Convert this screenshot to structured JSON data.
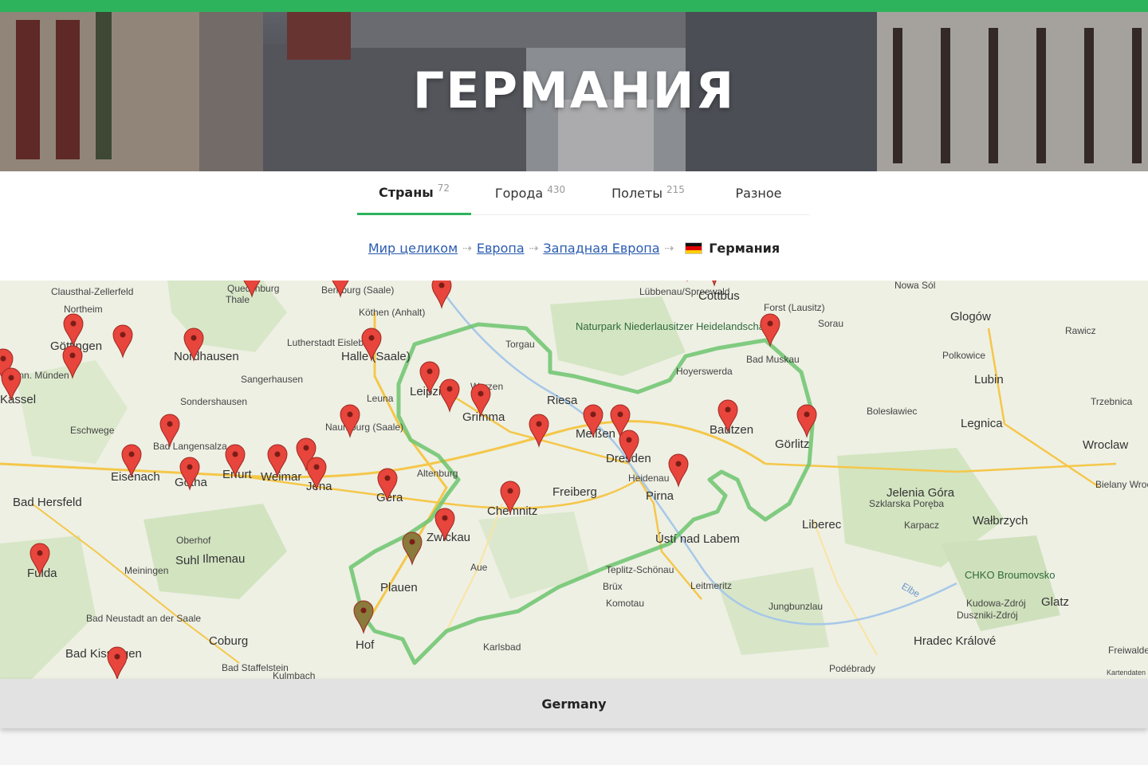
{
  "hero": {
    "title": "ГЕРМАНИЯ"
  },
  "tabs": [
    {
      "label": "Страны",
      "count": "72",
      "active": true
    },
    {
      "label": "Города",
      "count": "430",
      "active": false
    },
    {
      "label": "Полеты",
      "count": "215",
      "active": false
    },
    {
      "label": "Разное",
      "count": "",
      "active": false
    }
  ],
  "breadcrumb": {
    "items": [
      "Мир целиком",
      "Европа",
      "Западная Европа"
    ],
    "current": "Германия"
  },
  "map": {
    "caption": "Germany",
    "labels": [
      "Clausthal-Zellerfeld",
      "Quedlinburg",
      "Thale",
      "Bernburg (Saale)",
      "Köthen (Anhalt)",
      "Lübbenau/Spreewald",
      "Cottbus",
      "Nowa Sól",
      "Northeim",
      "Göttingen",
      "Nordhausen",
      "Lutherstadt Eisleben",
      "Halle (Saale)",
      "Torgau",
      "Naturpark Niederlausitzer Heidelandschaft",
      "Forst (Lausitz)",
      "Sorau",
      "Glogów",
      "Rawicz",
      "Hann. Münden",
      "Sangerhausen",
      "Wurzen",
      "Hoyerswerda",
      "Bad Muskau",
      "Polkowice",
      "Kassel",
      "Leuna",
      "Leipzig",
      "Lubin",
      "Sondershausen",
      "Riesa",
      "Bolesławiec",
      "Trzebnica",
      "Eschwege",
      "Bad Langensalza",
      "Grimma",
      "Meißen",
      "Bautzen",
      "Görlitz",
      "Legnica",
      "Naumburg (Saale)",
      "Dresden",
      "Wroclaw",
      "Eisenach",
      "Gotha",
      "Erfurt",
      "Weimar",
      "Jena",
      "Altenburg",
      "Heidenau",
      "Pirna",
      "Jelenia Góra",
      "Bielany Wrocławskie",
      "Bad Hersfeld",
      "Gera",
      "Freiberg",
      "Chemnitz",
      "Szklarska Poręba",
      "Karpacz",
      "Liberec",
      "Wałbrzych",
      "Oberhof",
      "Zwickau",
      "Ústí nad Labem",
      "Fulda",
      "Meiningen",
      "Suhl",
      "Ilmenau",
      "Aue",
      "Teplitz-Schönau",
      "CHKO Broumovsko",
      "Plauen",
      "Brüx",
      "Leitmeritz",
      "Kudowa-Zdrój",
      "Glatz",
      "Bad Neustadt an der Saale",
      "Komotau",
      "Jungbunzlau",
      "Duszniki-Zdrój",
      "Coburg",
      "Hof",
      "Hradec Králové",
      "Freiwalde",
      "Bad Kissingen",
      "Karlsbad",
      "Podébrady",
      "Bad Staffelstein",
      "Kulmbach",
      "Elbe",
      "Kartendaten"
    ],
    "colors": {
      "route": "#6cc46f",
      "marker": "#e8453c",
      "marker_visited": "#8a7a3c"
    }
  }
}
